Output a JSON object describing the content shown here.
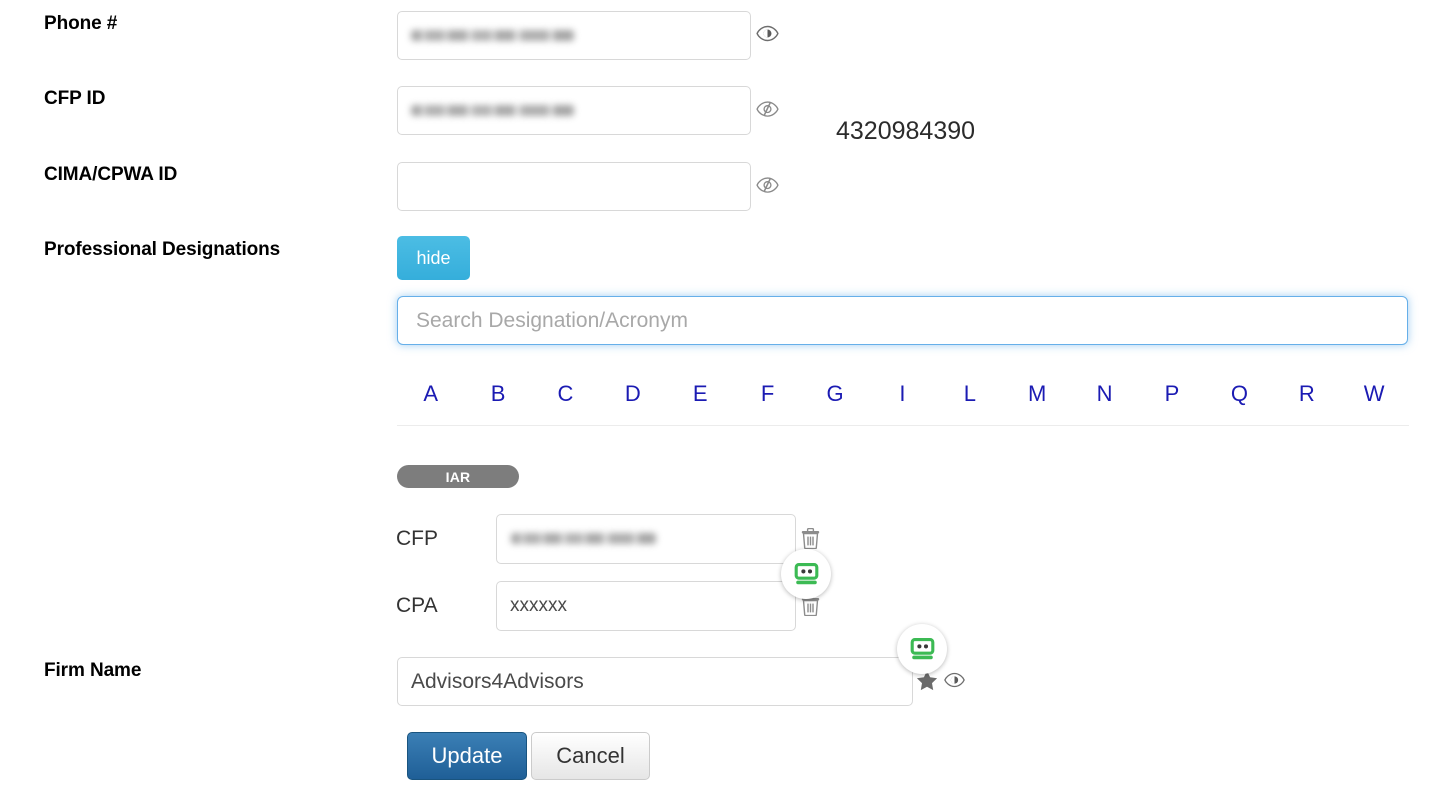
{
  "form": {
    "fields": [
      {
        "label": "Phone #",
        "value": "",
        "masked": true,
        "toggle_icon": "eye-icon"
      },
      {
        "label": "CFP ID",
        "value": "",
        "masked": true,
        "toggle_icon": "eye-slash-icon"
      },
      {
        "label": "CIMA/CPWA ID",
        "value": "",
        "masked": false,
        "toggle_icon": "eye-slash-icon"
      }
    ],
    "revealed_value": "4320984390",
    "designations_label": "Professional Designations",
    "firm_name_label": "Firm Name"
  },
  "designations": {
    "hide_button_label": "hide",
    "search_placeholder": "Search Designation/Acronym",
    "search_value": "",
    "alpha_index": [
      "A",
      "B",
      "C",
      "D",
      "E",
      "F",
      "G",
      "I",
      "L",
      "M",
      "N",
      "P",
      "Q",
      "R",
      "W"
    ],
    "group_badge": "IAR",
    "rows": [
      {
        "label": "CFP",
        "value": "",
        "masked": true,
        "delete_icon": "trash-icon"
      },
      {
        "label": "CPA",
        "value": "xxxxxx",
        "masked": false,
        "delete_icon": "trash-icon"
      }
    ]
  },
  "firm": {
    "value": "Advisors4Advisors",
    "favorite_icon": "star-icon",
    "visibility_icon": "eye-icon"
  },
  "footer": {
    "update_label": "Update",
    "cancel_label": "Cancel"
  },
  "overlays": {
    "robot_icon_name": "robot-assistant-icon",
    "count": 2
  },
  "colors": {
    "hide_button": "#3fb5e0",
    "primary_button": "#2a6ca6",
    "alpha_link": "#1b1bb3",
    "badge": "#7d7d7d",
    "robot_green": "#3cba54",
    "focus_blue": "#66afe9"
  }
}
